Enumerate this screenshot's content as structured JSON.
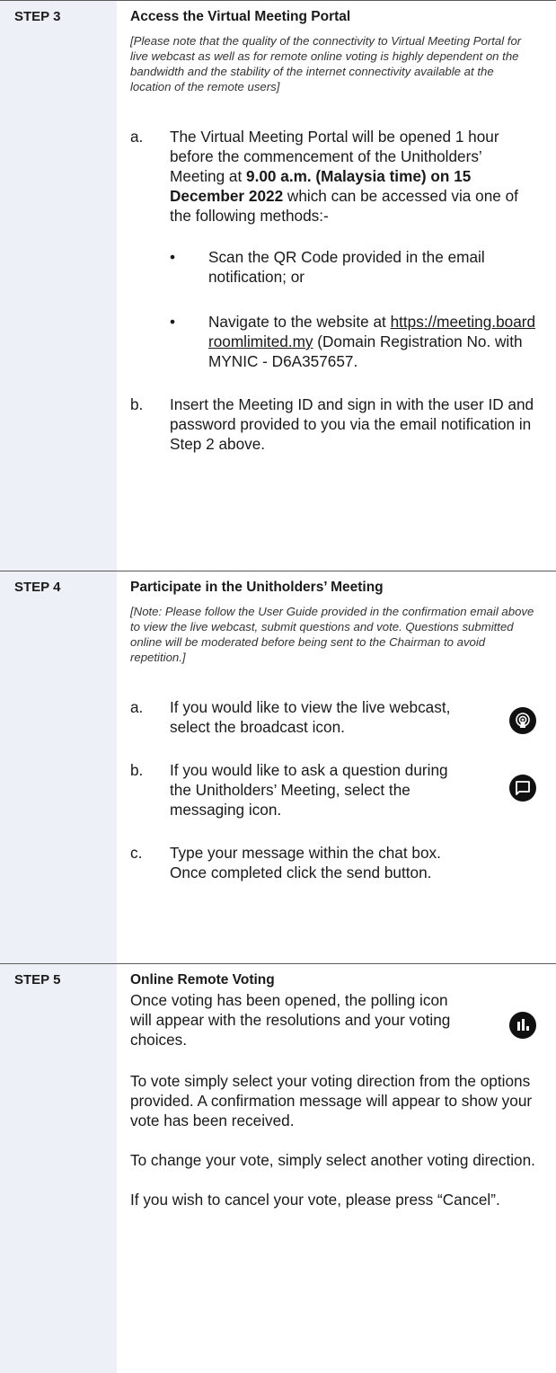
{
  "steps": [
    {
      "label": "STEP 3",
      "title": "Access the Virtual Meeting Portal",
      "note": "[Please note that the quality of the connectivity to Virtual Meeting Portal for live webcast as well as for remote online voting is highly dependent on the bandwidth and the stability of the internet connectivity available at the location of the remote users]",
      "a_marker": "a.",
      "a_text_1": "The Virtual Meeting Portal will be opened 1 hour before the commencement of the Unitholders’ Meeting at ",
      "a_bold": "9.00 a.m. (Malaysia time) on 15 December 2022",
      "a_text_2": " which can be accessed via one of the following methods:-",
      "bullet_symbol": "•",
      "bullet_1": "Scan the QR Code provided in the email notification; or",
      "bullet_2_pre": "Navigate to the website at ",
      "bullet_2_link": "https://meeting.boardroomlimited.my",
      "bullet_2_post": " (Domain Registration No. with MYNIC - D6A357657.",
      "b_marker": "b.",
      "b_text": "Insert the Meeting ID and sign in with the user ID and password provided to you via the email notification in Step 2 above."
    },
    {
      "label": "STEP 4",
      "title": "Participate in the Unitholders’ Meeting",
      "note": "[Note: Please follow the User Guide provided in the confirmation email above to view the live webcast, submit questions and vote. Questions submitted online will be moderated before being sent to the Chairman to avoid repetition.]",
      "items": [
        {
          "marker": "a.",
          "text": "If you would like to view the live webcast, select the broadcast icon.",
          "icon": "broadcast-icon"
        },
        {
          "marker": "b.",
          "text": "If you would like to ask a question during the Unitholders’ Meeting, select the messaging icon.",
          "icon": "messaging-icon"
        },
        {
          "marker": "c.",
          "text": "Type your message within the chat box. Once completed click the send button."
        }
      ]
    },
    {
      "label": "STEP 5",
      "title": "Online Remote Voting",
      "intro": "Once voting has been opened, the polling icon will appear with the resolutions and your voting choices.",
      "icon": "polling-icon",
      "p1": "To vote simply select your voting direction from the options provided. A confirmation message will appear to show your vote has been received.",
      "p2": "To change your vote, simply select another voting direction.",
      "p3": "If you wish to cancel your vote, please press “Cancel”."
    }
  ]
}
